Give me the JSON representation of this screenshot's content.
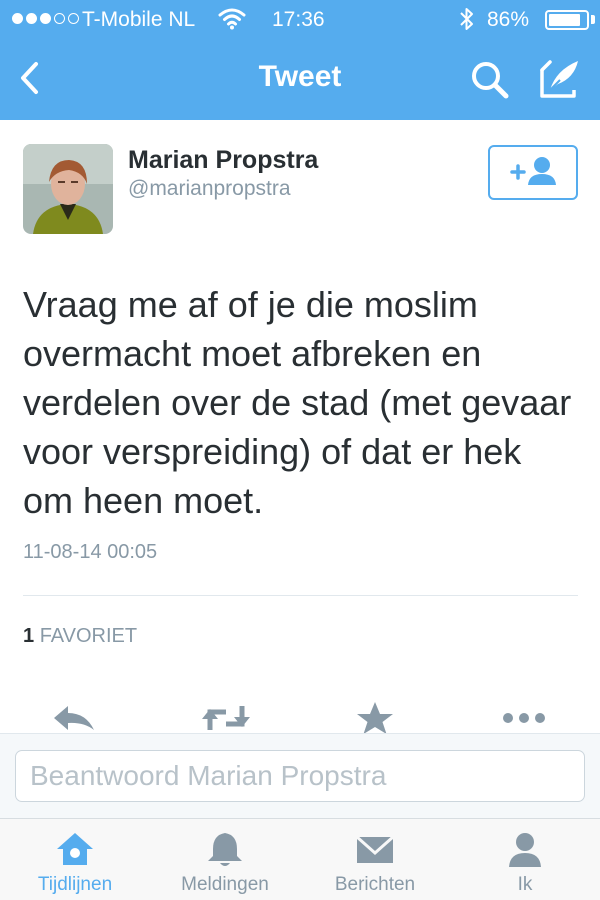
{
  "status_bar": {
    "signal_filled": 3,
    "signal_empty": 2,
    "carrier": "T-Mobile NL",
    "time": "17:36",
    "battery_percent": "86%",
    "battery_level": 0.86,
    "icons": [
      "wifi-icon",
      "bluetooth-icon",
      "battery-icon"
    ]
  },
  "nav": {
    "title": "Tweet",
    "icons": [
      "back-icon",
      "search-icon",
      "compose-icon"
    ]
  },
  "tweet": {
    "author_name": "Marian Propstra",
    "author_handle": "@marianpropstra",
    "text_lines": [
      "Vraag me af of je die moslim",
      "overmacht moet afbreken en",
      "verdelen over de stad (met gevaar",
      "voor verspreiding) of dat er hek",
      "om heen moet."
    ],
    "timestamp": "11-08-14 00:05",
    "favorite_count": "1",
    "favorite_label": "FAVORIET",
    "actions": [
      "reply-icon",
      "retweet-icon",
      "favorite-icon",
      "more-icon"
    ]
  },
  "reply": {
    "placeholder": "Beantwoord Marian Propstra"
  },
  "tabbar": {
    "tabs": [
      {
        "label": "Tijdlijnen",
        "icon": "home-icon",
        "active": true
      },
      {
        "label": "Meldingen",
        "icon": "bell-icon",
        "active": false
      },
      {
        "label": "Berichten",
        "icon": "envelope-icon",
        "active": false
      },
      {
        "label": "Ik",
        "icon": "person-icon",
        "active": false
      }
    ]
  },
  "colors": {
    "accent": "#55acee",
    "text": "#292f33",
    "muted": "#8899a6",
    "icon_gray": "#8899a6"
  }
}
